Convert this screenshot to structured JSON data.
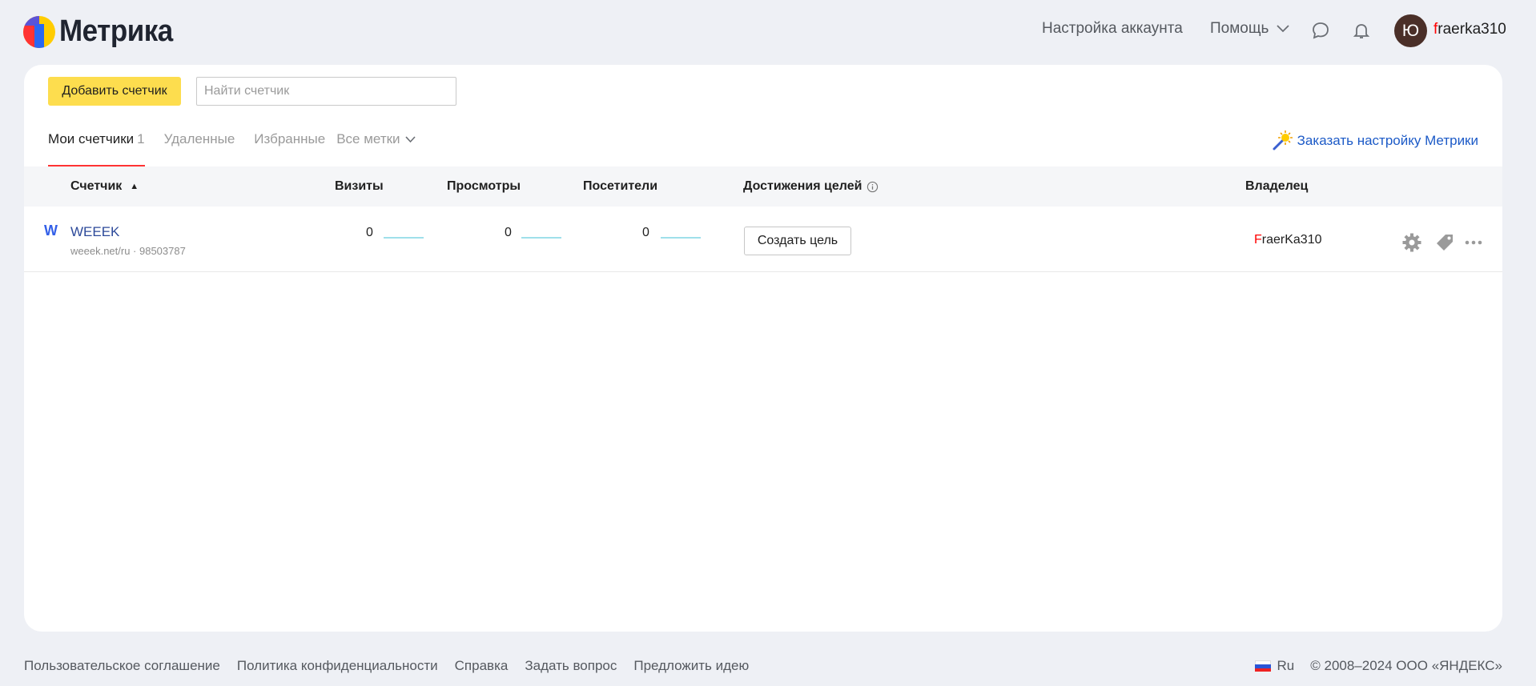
{
  "header": {
    "logo_text": "Метрика",
    "account_settings": "Настройка аккаунта",
    "help": "Помощь",
    "avatar_letter": "Ю",
    "username_first": "f",
    "username_rest": "raerka310"
  },
  "toolbar": {
    "add_counter": "Добавить счетчик",
    "search_placeholder": "Найти счетчик",
    "search_value": ""
  },
  "tabs": [
    {
      "label": "Мои счетчики",
      "count": "1",
      "active": true
    },
    {
      "label": "Удаленные",
      "count": "",
      "active": false
    },
    {
      "label": "Избранные",
      "count": "",
      "active": false
    },
    {
      "label": "Все метки",
      "count": "",
      "active": false
    }
  ],
  "order_setup": "Заказать настройку Метрики",
  "columns": {
    "counter": "Счетчик",
    "sort_indicator": "▲",
    "visits": "Визиты",
    "views": "Просмотры",
    "visitors": "Посетители",
    "goals": "Достижения целей",
    "owner": "Владелец"
  },
  "rows": [
    {
      "favicon": "W",
      "name": "WEEEK",
      "site": "weeek.net/ru · 98503787",
      "visits": "0",
      "views": "0",
      "visitors": "0",
      "goal_button": "Создать цель",
      "owner_first": "F",
      "owner_rest": "raerKa310"
    }
  ],
  "footer": {
    "links": [
      "Пользовательское соглашение",
      "Политика конфиденциальности",
      "Справка",
      "Задать вопрос",
      "Предложить идею"
    ],
    "lang": "Ru",
    "copyright": "© 2008–2024 ООО «ЯНДЕКС»"
  },
  "colors": {
    "accent_yellow": "#fddd4e",
    "link_blue": "#1c5ac7",
    "tab_underline": "#ff3333",
    "sparkline": "#9fe0ea"
  }
}
